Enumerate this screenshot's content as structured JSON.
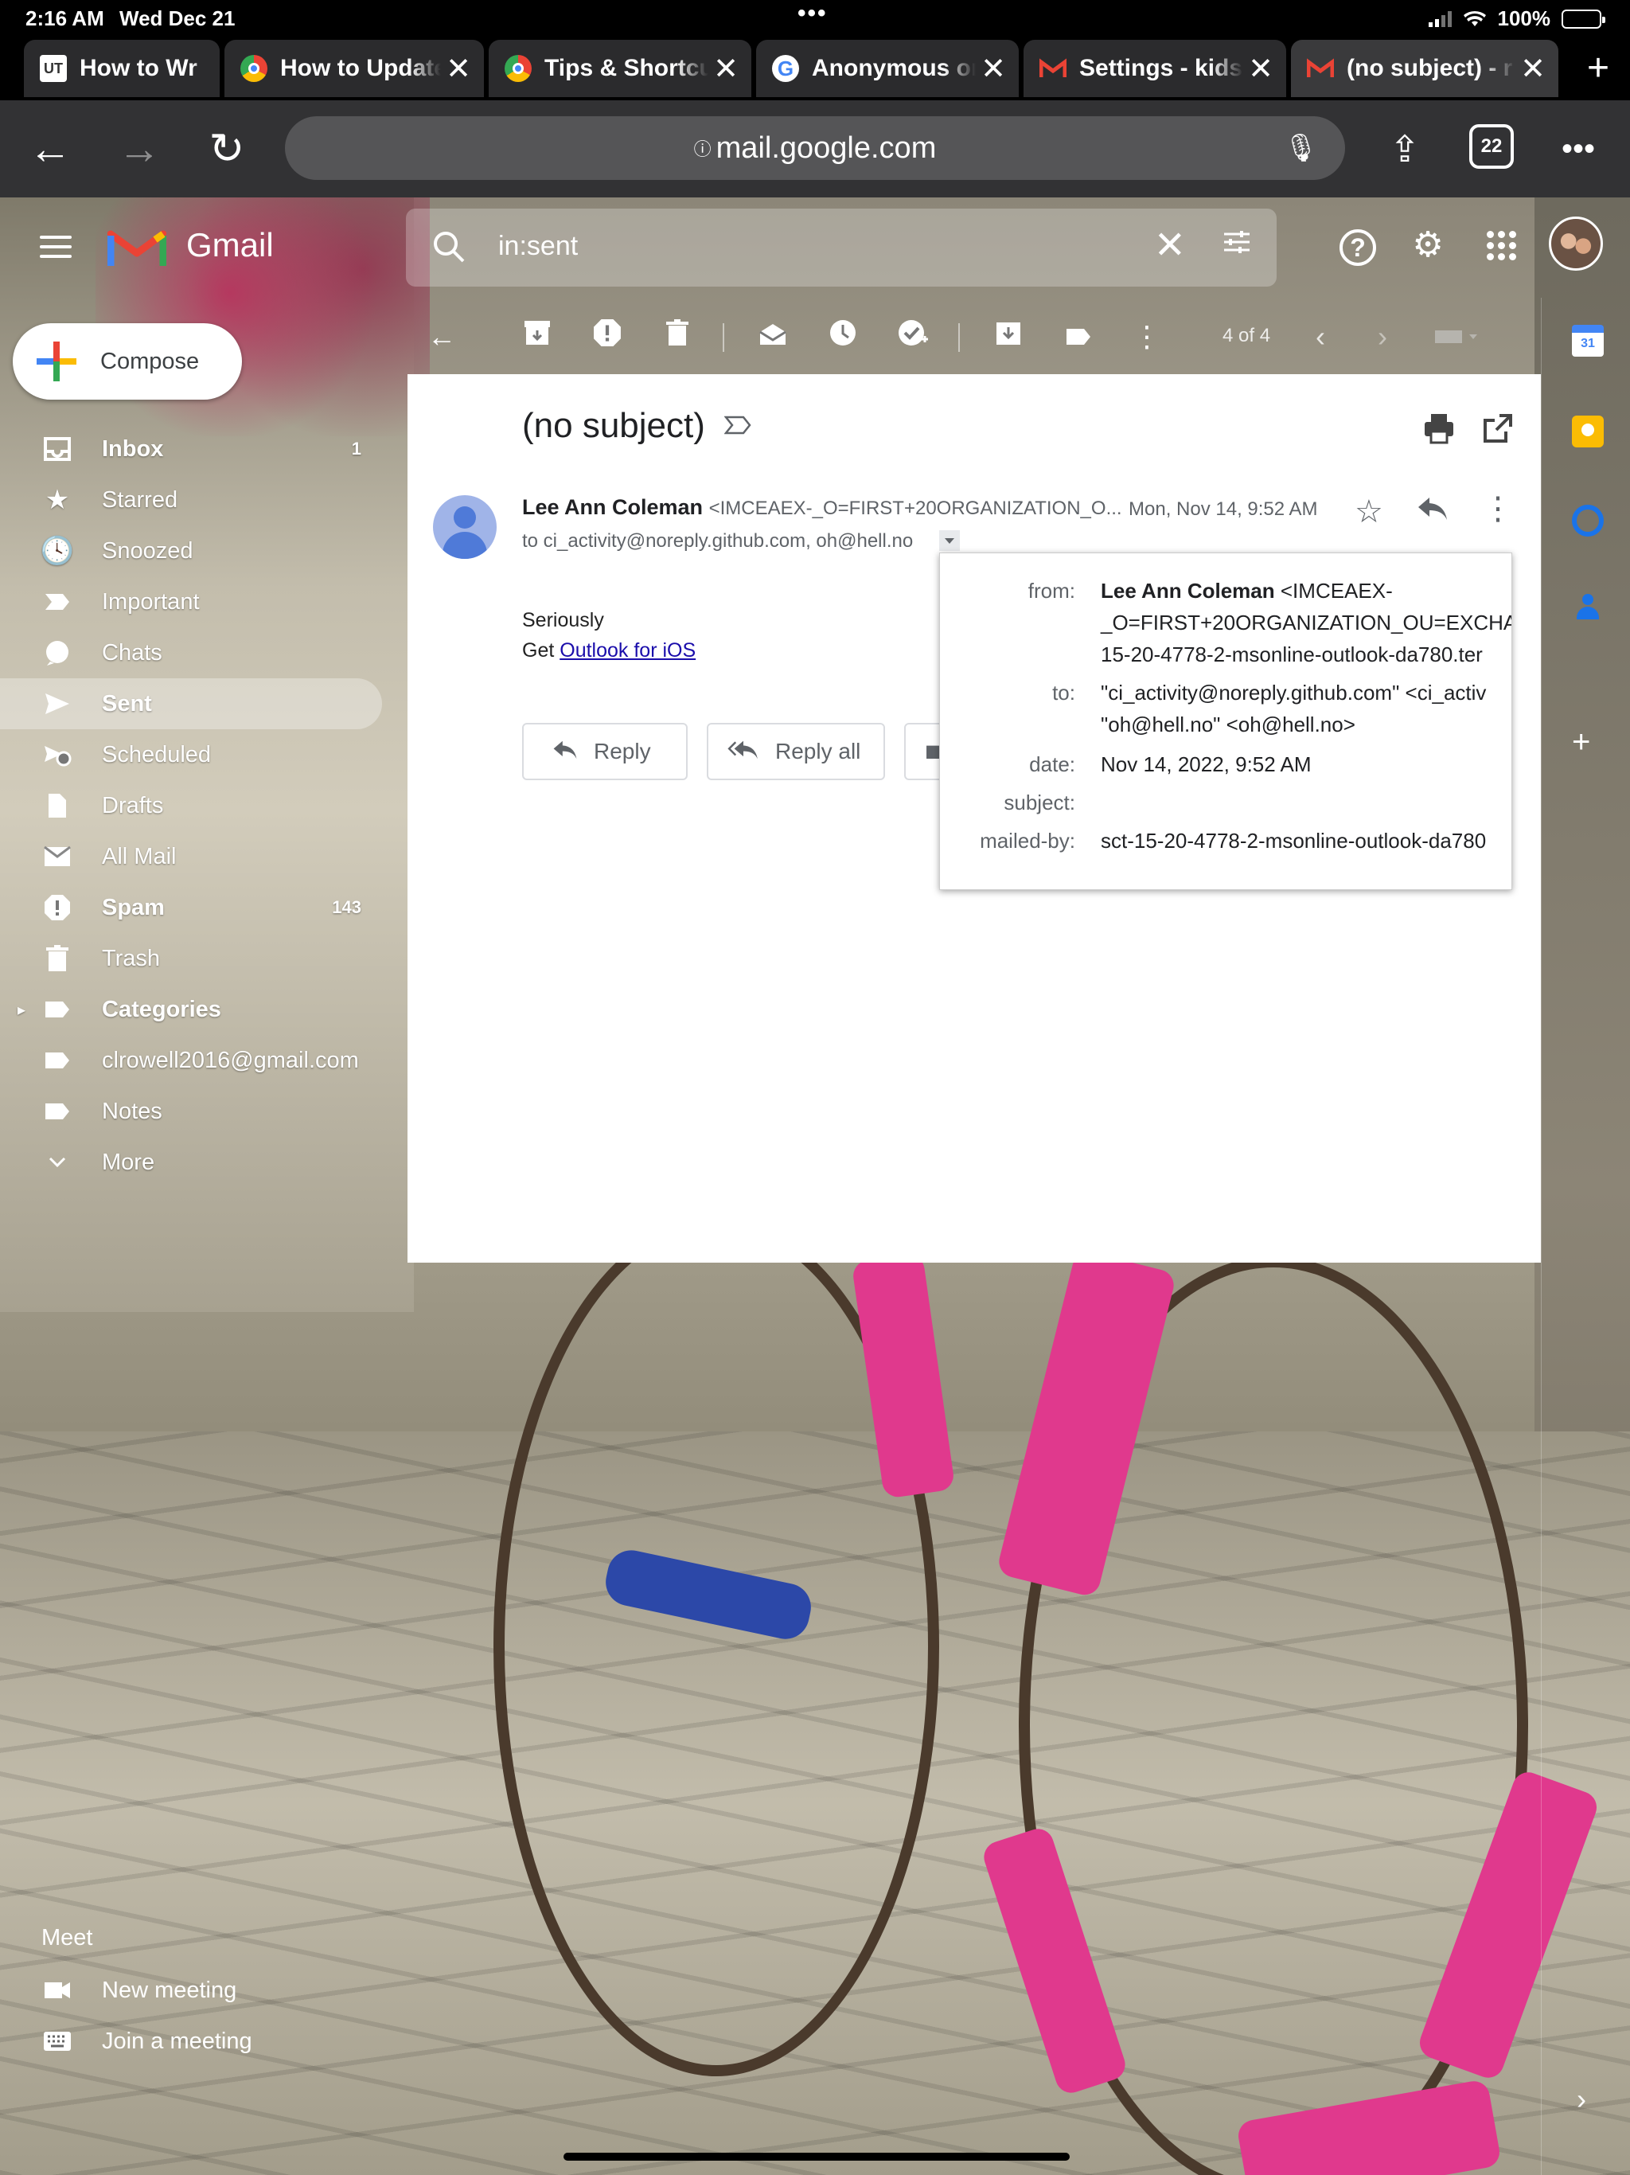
{
  "status_bar": {
    "time": "2:16 AM",
    "date": "Wed Dec 21",
    "battery": "100%"
  },
  "tabs": [
    {
      "label": "How to Wr",
      "favicon": "UT"
    },
    {
      "label": "How to Update",
      "favicon": "chrome-icon"
    },
    {
      "label": "Tips & Shortcu",
      "favicon": "chrome-icon"
    },
    {
      "label": "Anonymous or",
      "favicon": "google-icon"
    },
    {
      "label": "Settings - kids",
      "favicon": "gmail-icon"
    },
    {
      "label": "(no subject) - r",
      "favicon": "gmail-icon"
    }
  ],
  "browser": {
    "url": "mail.google.com",
    "tab_count": "22"
  },
  "gmail": {
    "brand": "Gmail",
    "search_query": "in:sent",
    "compose_label": "Compose"
  },
  "nav": {
    "items": [
      {
        "label": "Inbox",
        "count": "1",
        "icon": "inbox-icon"
      },
      {
        "label": "Starred",
        "count": "",
        "icon": "star-icon"
      },
      {
        "label": "Snoozed",
        "count": "",
        "icon": "clock-icon"
      },
      {
        "label": "Important",
        "count": "",
        "icon": "important-icon"
      },
      {
        "label": "Chats",
        "count": "",
        "icon": "chat-icon"
      },
      {
        "label": "Sent",
        "count": "",
        "icon": "send-icon"
      },
      {
        "label": "Scheduled",
        "count": "",
        "icon": "scheduled-icon"
      },
      {
        "label": "Drafts",
        "count": "",
        "icon": "draft-icon"
      },
      {
        "label": "All Mail",
        "count": "",
        "icon": "mail-icon"
      },
      {
        "label": "Spam",
        "count": "143",
        "icon": "spam-icon"
      },
      {
        "label": "Trash",
        "count": "",
        "icon": "trash-icon"
      },
      {
        "label": "Categories",
        "count": "",
        "icon": "label-icon"
      },
      {
        "label": "clrowell2016@gmail.com",
        "count": "",
        "icon": "label-icon"
      },
      {
        "label": "Notes",
        "count": "",
        "icon": "label-icon"
      },
      {
        "label": "More",
        "count": "",
        "icon": "chevron-down-icon"
      }
    ],
    "meet_title": "Meet",
    "meet_items": [
      {
        "label": "New meeting",
        "icon": "video-icon"
      },
      {
        "label": "Join a meeting",
        "icon": "keyboard-icon"
      }
    ]
  },
  "message_toolbar": {
    "pager": "4 of 4"
  },
  "message": {
    "subject": "(no subject)",
    "sender_name": "Lee Ann Coleman",
    "sender_addr": "<IMCEAEX-_O=FIRST+20ORGANIZATION_O...",
    "date": "Mon, Nov 14, 9:52 AM",
    "to_line": "to ci_activity@noreply.github.com, oh@hell.no",
    "body_line1": "Seriously",
    "body_line2_prefix": "Get ",
    "body_link": "Outlook for iOS",
    "reply_label": "Reply",
    "reply_all_label": "Reply all"
  },
  "details": {
    "from_label": "from:",
    "from_name": "Lee Ann Coleman",
    "from_addr1": "<IMCEAEX-",
    "from_addr2": "_O=FIRST+20ORGANIZATION_OU=EXCHA",
    "from_addr3": "15-20-4778-2-msonline-outlook-da780.ter",
    "to_label": "to:",
    "to_value1": "\"ci_activity@noreply.github.com\" <ci_activ",
    "to_value2": "\"oh@hell.no\" <oh@hell.no>",
    "date_label": "date:",
    "date_value": "Nov 14, 2022, 9:52 AM",
    "subject_label": "subject:",
    "mailedby_label": "mailed-by:",
    "mailedby_value": "sct-15-20-4778-2-msonline-outlook-da780"
  },
  "side_panel": {
    "calendar_day": "31"
  }
}
